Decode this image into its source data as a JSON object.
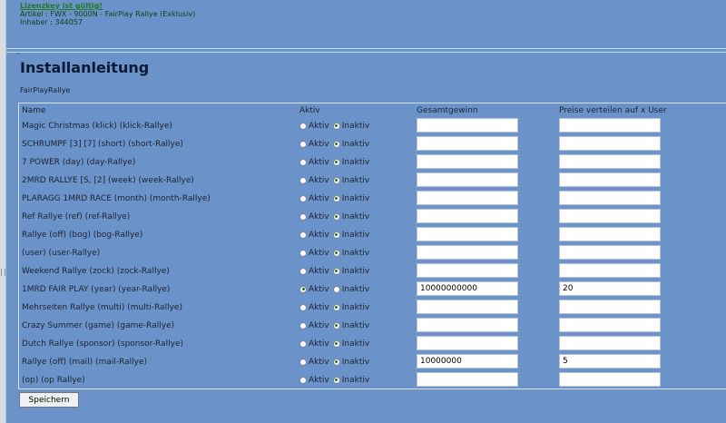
{
  "license": {
    "status": "Lizenzkey ist gültig!",
    "artikel": "Artikel : FWX - 9000N - FairPlay Rallye (Exklusiv)",
    "inhaber": "Inhaber : 344057"
  },
  "page_title": "Installanleitung",
  "subtitle": "FairPlayRallye",
  "table": {
    "headers": {
      "name": "Name",
      "aktiv": "Aktiv",
      "gesamtgewinn": "Gesamtgewinn",
      "preise": "Preise verteilen auf x User"
    },
    "aktiv_label": "Aktiv",
    "inaktiv_label": "Inaktiv",
    "rows": [
      {
        "name": "Magic Christmas (klick) (klick-Rallye)",
        "active": false,
        "gesamtgewinn": "",
        "preise": ""
      },
      {
        "name": "SCHRUMPF [3] [7] (short) (short-Rallye)",
        "active": false,
        "gesamtgewinn": "",
        "preise": ""
      },
      {
        "name": "7 POWER (day) (day-Rallye)",
        "active": false,
        "gesamtgewinn": "",
        "preise": ""
      },
      {
        "name": "2MRD RALLYE [S, [2] (week) (week-Rallye)",
        "active": false,
        "gesamtgewinn": "",
        "preise": ""
      },
      {
        "name": "PLARAGG 1MRD RACE (month) (month-Rallye)",
        "active": false,
        "gesamtgewinn": "",
        "preise": ""
      },
      {
        "name": "Ref Rallye (ref) (ref-Rallye)",
        "active": false,
        "gesamtgewinn": "",
        "preise": ""
      },
      {
        "name": "Rallye (off) (bog) (bog-Rallye)",
        "active": false,
        "gesamtgewinn": "",
        "preise": ""
      },
      {
        "name": "(user) (user-Rallye)",
        "active": false,
        "gesamtgewinn": "",
        "preise": ""
      },
      {
        "name": "Weekend Rallye (zock) (zock-Rallye)",
        "active": false,
        "gesamtgewinn": "",
        "preise": ""
      },
      {
        "name": "1MRD FAIR PLAY (year) (year-Rallye)",
        "active": true,
        "gesamtgewinn": "10000000000",
        "preise": "20"
      },
      {
        "name": "Mehrseiten Rallye (multi) (multi-Rallye)",
        "active": false,
        "gesamtgewinn": "",
        "preise": ""
      },
      {
        "name": "Crazy Summer (game) (game-Rallye)",
        "active": false,
        "gesamtgewinn": "",
        "preise": ""
      },
      {
        "name": "Dutch Rallye (sponsor) (sponsor-Rallye)",
        "active": false,
        "gesamtgewinn": "",
        "preise": ""
      },
      {
        "name": "Rallye (off) (mail) (mail-Rallye)",
        "active": false,
        "gesamtgewinn": "10000000",
        "preise": "5"
      },
      {
        "name": "(op) (op Rallye)",
        "active": false,
        "gesamtgewinn": "",
        "preise": ""
      }
    ]
  },
  "save_label": "Speichern",
  "colors": {
    "background": "#6b93c9",
    "license_ok": "#1e7c1e",
    "radio_selected": "#1f7a2a"
  }
}
